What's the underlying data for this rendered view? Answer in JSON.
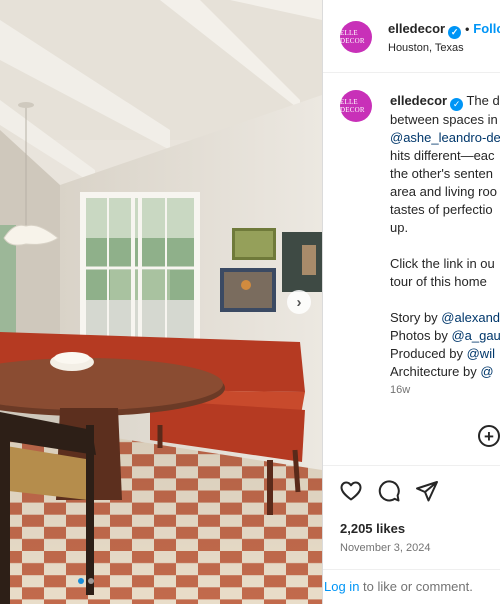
{
  "post": {
    "username": "elledecor",
    "avatar_text": "ELLE DECOR",
    "follow_label": "Follow",
    "separator": "•",
    "location": "Houston, Texas",
    "verified_glyph": "✓"
  },
  "caption": {
    "username": "elledecor",
    "lines": [
      "The d",
      "between spaces in",
      "@ashe_leandro-de",
      "hits different—eac",
      "the other's senten",
      "area and living roo",
      "tastes of perfectio",
      "up.",
      "",
      "Click the link in ou",
      "tour of this home",
      "",
      "Story by @alexand",
      "Photos by @a_gau",
      "Produced by @wil",
      "Architecture by @"
    ],
    "mentions": [
      "@ashe_leandro-de",
      "@alexand",
      "@a_gau",
      "@wil",
      "@"
    ],
    "time_ago": "16w"
  },
  "actions": {
    "like_icon": "heart-icon",
    "comment_icon": "comment-icon",
    "share_icon": "share-icon",
    "add_comment_icon": "add-comment-icon"
  },
  "stats": {
    "likes": "2,205 likes",
    "date": "November 3, 2024"
  },
  "footer": {
    "login_link": "Log in",
    "login_rest": " to like or comment."
  },
  "carousel": {
    "next_glyph": "›",
    "slide_count": 2,
    "active_slide": 1
  },
  "colors": {
    "brand_avatar": "#c830b8",
    "link_blue": "#0095f6",
    "mention_blue": "#00376b",
    "sofa_red": "#b53a22"
  }
}
